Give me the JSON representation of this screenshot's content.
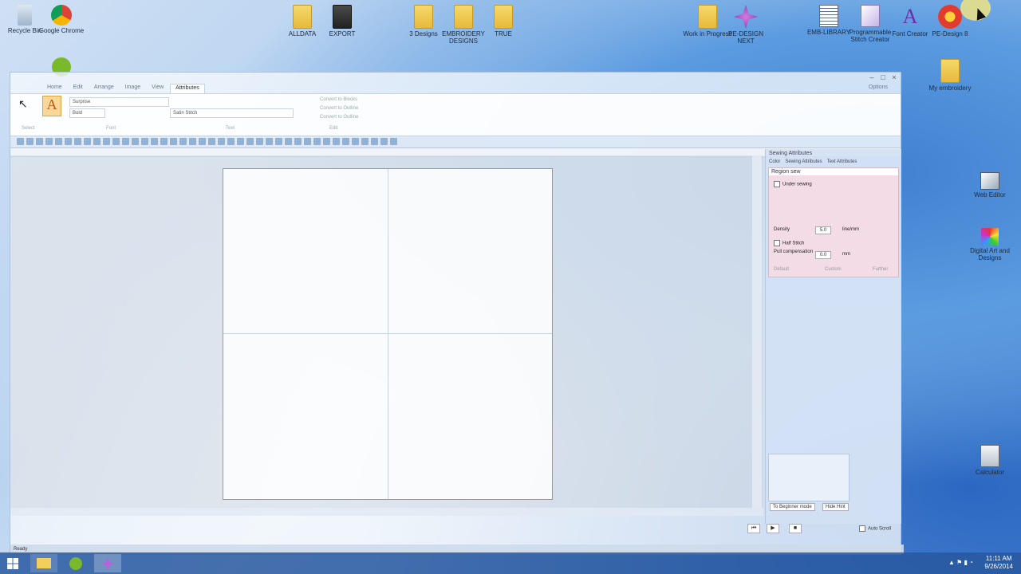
{
  "desktop": {
    "icons_top": [
      {
        "label": "Recycle Bin",
        "glyph": "recycle-bin-icon"
      },
      {
        "label": "Google Chrome",
        "glyph": "chrome-icon"
      },
      {
        "label": "ALLDATA",
        "glyph": "folder-icon"
      },
      {
        "label": "EXPORT",
        "glyph": "folder-icon"
      },
      {
        "label": "3 Designs",
        "glyph": "folder-icon"
      },
      {
        "label": "EMBROIDERY DESIGNS",
        "glyph": "folder-icon"
      },
      {
        "label": "TRUE",
        "glyph": "folder-icon"
      },
      {
        "label": "Work in Progress",
        "glyph": "folder-icon"
      },
      {
        "label": "PE-DESIGN NEXT",
        "glyph": "pe-design-icon"
      },
      {
        "label": "EMB-LIBRARY",
        "glyph": "document-icon"
      },
      {
        "label": "Programmable Stitch Creator",
        "glyph": "stitch-creator-icon"
      },
      {
        "label": "Font Creator",
        "glyph": "font-creator-icon"
      },
      {
        "label": "PE-Design 8",
        "glyph": "pe-design-flower-icon"
      }
    ],
    "icons_right": [
      {
        "label": "My embroidery",
        "glyph": "folder-icon"
      },
      {
        "label": "Web Editor",
        "glyph": "shortcut-icon"
      },
      {
        "label": "Digital Art and Designs",
        "glyph": "shortcut-icon"
      },
      {
        "label": "Calculator",
        "glyph": "shortcut-icon"
      }
    ],
    "icons_left": [
      {
        "label": "Spotify",
        "glyph": "spotify-icon"
      }
    ]
  },
  "app": {
    "ribbon_tabs": [
      "Home",
      "Edit",
      "Arrange",
      "Image",
      "View",
      "Attributes"
    ],
    "active_tab": "Attributes",
    "options_label": "Options",
    "font_field": "Surprise",
    "size_field": "Bold",
    "thread_field": "Satin Stitch",
    "convert": [
      "Convert to Blocks",
      "Convert to Outline",
      "Convert to Outline"
    ],
    "group_labels": [
      "Select",
      "Font",
      "Text",
      "Edit"
    ],
    "status_text": "Ready"
  },
  "panel": {
    "title": "Sewing Attributes",
    "tabs": [
      "Color",
      "Sewing Attributes",
      "Text Attributes"
    ],
    "section": "Region sew",
    "under_sewing": "Under sewing",
    "density_label": "Density",
    "density_value": "5.0",
    "density_unit": "line/mm",
    "half_stitch": "Half Stitch",
    "pull_label": "Pull compensation",
    "pull_value": "0.0",
    "pull_unit": "mm",
    "direction_options": [
      "Default",
      "Custom",
      "Further"
    ],
    "to_beginner": "To Beginner mode",
    "hide_hint": "Hide Hint",
    "auto_scroll": "Auto Scroll"
  },
  "taskbar": {
    "time": "11:11 AM",
    "date": "9/26/2014"
  }
}
